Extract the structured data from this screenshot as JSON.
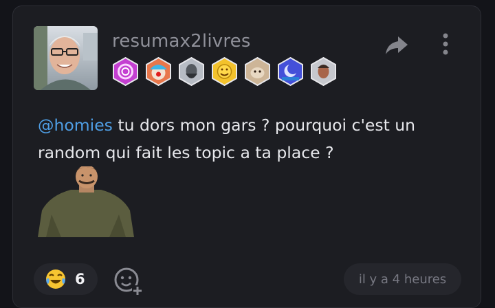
{
  "post": {
    "username": "resumax2livres",
    "badges": [
      {
        "icon": "spiral-galaxy-badge-icon",
        "color": "#c43fd1"
      },
      {
        "icon": "clown-face-badge-icon",
        "color": "#d9583a"
      },
      {
        "icon": "bearded-man-badge-icon",
        "color": "#9aa0a8"
      },
      {
        "icon": "smiling-emoji-badge-icon",
        "color": "#f2c230"
      },
      {
        "icon": "dog-badge-icon",
        "color": "#b79d82"
      },
      {
        "icon": "moon-night-badge-icon",
        "color": "#3d4fd6"
      },
      {
        "icon": "man-portrait-badge-icon",
        "color": "#b0b2b8"
      }
    ],
    "mention": "@homies",
    "message_text": " tu dors mon gars ? pourquoi c'est un random qui fait les topic a ta place ?",
    "reaction": {
      "emoji": "😂",
      "count": "6"
    },
    "timestamp": "il y a 4 heures"
  },
  "colors": {
    "background": "#131419",
    "card": "#1c1d22",
    "mention": "#4f9fe6",
    "text": "#e7e8ec",
    "muted": "#8f9099"
  }
}
